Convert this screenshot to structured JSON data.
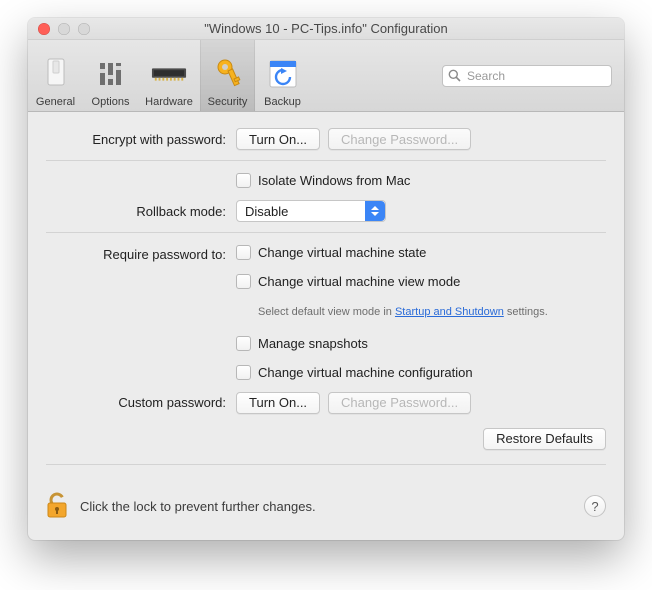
{
  "window": {
    "title": "\"Windows 10 - PC-Tips.info\" Configuration"
  },
  "toolbar": {
    "items": [
      {
        "id": "general",
        "label": "General",
        "selected": false
      },
      {
        "id": "options",
        "label": "Options",
        "selected": false
      },
      {
        "id": "hardware",
        "label": "Hardware",
        "selected": false
      },
      {
        "id": "security",
        "label": "Security",
        "selected": true
      },
      {
        "id": "backup",
        "label": "Backup",
        "selected": false
      }
    ],
    "search_placeholder": "Search"
  },
  "sections": {
    "encrypt": {
      "label": "Encrypt with password:",
      "turn_on": "Turn On...",
      "change_pw": "Change Password..."
    },
    "isolation": {
      "isolate_label": "Isolate Windows from Mac",
      "rollback_label": "Rollback mode:",
      "rollback_value": "Disable"
    },
    "require": {
      "label": "Require password to:",
      "items": [
        "Change virtual machine state",
        "Change virtual machine view mode"
      ],
      "hint_prefix": "Select default view mode in ",
      "hint_link": "Startup and Shutdown",
      "hint_suffix": " settings.",
      "items2": [
        "Manage snapshots",
        "Change virtual machine configuration"
      ]
    },
    "custom": {
      "label": "Custom password:",
      "turn_on": "Turn On...",
      "change_pw": "Change Password..."
    },
    "restore_defaults": "Restore Defaults"
  },
  "footer": {
    "lock_text": "Click the lock to prevent further changes.",
    "help": "?"
  }
}
